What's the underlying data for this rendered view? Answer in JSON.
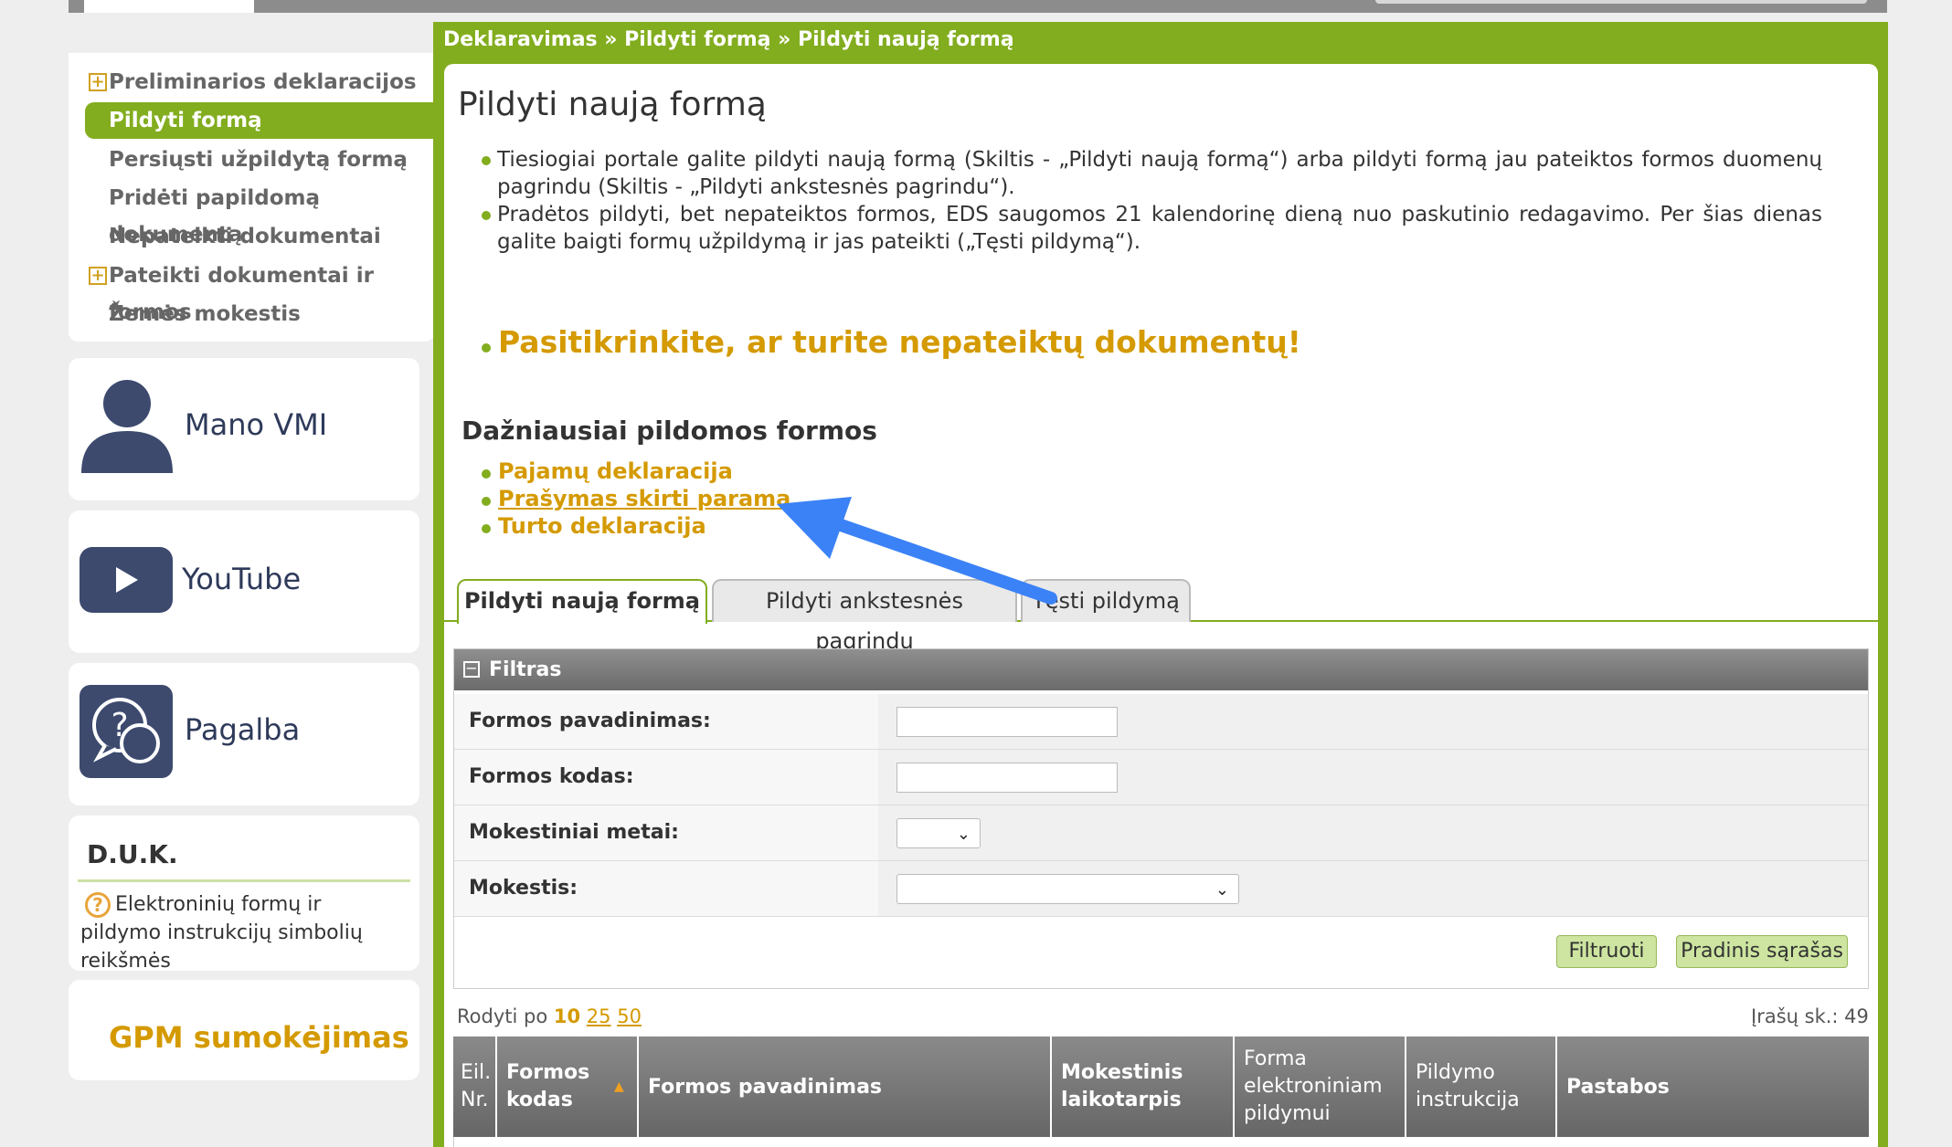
{
  "left_nav": {
    "items": [
      {
        "label": "Preliminarios deklaracijos",
        "expandable": true
      },
      {
        "label": "Pildyti formą",
        "active": true
      },
      {
        "label": "Persiųsti užpildytą formą"
      },
      {
        "label": "Pridėti papildomą dokumentą"
      },
      {
        "label": "Nepateikti dokumentai"
      },
      {
        "label": "Pateikti dokumentai ir formos",
        "expandable": true
      },
      {
        "label": "Žemės mokestis"
      }
    ],
    "expand_symbol": "+"
  },
  "cards": {
    "mano_vmi": "Mano VMI",
    "youtube": "YouTube",
    "pagalba": "Pagalba",
    "duk_title": "D.U.K.",
    "duk_link": "Elektroninių formų ir pildymo instrukcijų simbolių reikšmės",
    "duk_icon_symbol": "?",
    "gpm": "GPM sumokėjimas"
  },
  "breadcrumb": "Deklaravimas » Pildyti formą » Pildyti naują formą",
  "page_title": "Pildyti naują formą",
  "paragraphs": [
    "Tiesiogiai portale galite pildyti naują formą (Skiltis - „Pildyti naują formą“) arba pildyti formą jau pateiktos formos duomenų pagrindu (Skiltis - „Pildyti ankstesnės pagrindu“).",
    "Pradėtos pildyti, bet nepateiktos formos, EDS saugomos 21 kalendorinę dieną nuo paskutinio redagavimo. Per šias dienas galite baigti formų užpildymą ir jas pateikti („Tęsti pildymą“)."
  ],
  "warning": "Pasitikrinkite, ar turite nepateiktų dokumentų!",
  "frequent": {
    "title": "Dažniausiai pildomos formos",
    "links": [
      "Pajamų deklaracija",
      "Prašymas skirti paramą",
      "Turto deklaracija"
    ]
  },
  "tabs": [
    "Pildyti naują formą",
    "Pildyti ankstesnės pagrindu",
    "Tęsti pildymą"
  ],
  "filter": {
    "title": "Filtras",
    "collapse_symbol": "−",
    "rows": [
      {
        "label": "Formos pavadinimas:",
        "value": ""
      },
      {
        "label": "Formos kodas:",
        "value": ""
      },
      {
        "label": "Mokestiniai metai:",
        "value": ""
      },
      {
        "label": "Mokestis:",
        "value": ""
      }
    ],
    "select_chevron": "⌄",
    "filter_button": "Filtruoti",
    "reset_button": "Pradinis sąrašas"
  },
  "pager": {
    "show_label": "Rodyti po",
    "current": "10",
    "options": [
      "25",
      "50"
    ],
    "records_label": "Įrašų sk.: 49"
  },
  "table": {
    "columns": [
      "Eil. Nr.",
      "Formos kodas",
      "Formos pavadinimas",
      "Mokestinis laikotarpis",
      "Forma elektroniniam pildymui",
      "Pildymo instrukcija",
      "Pastabos"
    ],
    "sort_symbol": "▲"
  },
  "colors": {
    "brand_green": "#82ad1e",
    "accent_gold": "#d49a00",
    "arrow_blue": "#3b82f6",
    "icon_navy": "#3d4a6e"
  }
}
